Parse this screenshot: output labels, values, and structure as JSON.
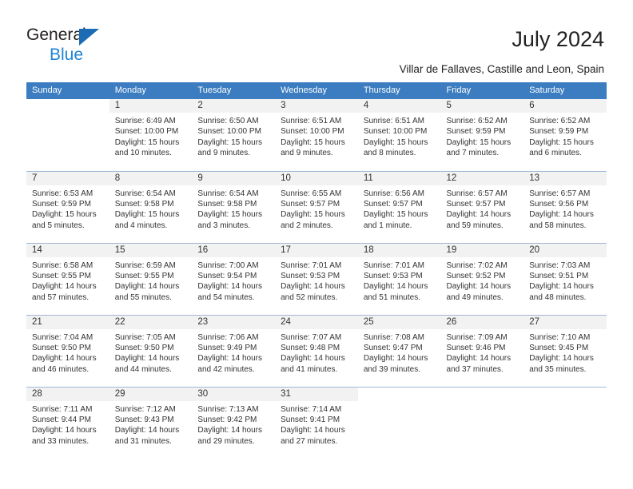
{
  "brand": {
    "name_part1": "General",
    "name_part2": "Blue",
    "logo_icon": "triangle-logo-icon",
    "color_dark": "#231f20",
    "color_blue": "#1f83d4",
    "color_triangle": "#1b6cb5"
  },
  "header": {
    "title": "July 2024",
    "subtitle": "Villar de Fallaves, Castille and Leon, Spain"
  },
  "theme": {
    "header_row_bg": "#3b7dc0",
    "header_row_text": "#ffffff",
    "daynum_band_bg": "#f2f2f2",
    "row_separator": "#9fb8d4",
    "body_text": "#333333"
  },
  "calendar": {
    "weekday_headers": [
      "Sunday",
      "Monday",
      "Tuesday",
      "Wednesday",
      "Thursday",
      "Friday",
      "Saturday"
    ],
    "weeks": [
      [
        {
          "day": "",
          "lines": []
        },
        {
          "day": "1",
          "lines": [
            "Sunrise: 6:49 AM",
            "Sunset: 10:00 PM",
            "Daylight: 15 hours",
            "and 10 minutes."
          ]
        },
        {
          "day": "2",
          "lines": [
            "Sunrise: 6:50 AM",
            "Sunset: 10:00 PM",
            "Daylight: 15 hours",
            "and 9 minutes."
          ]
        },
        {
          "day": "3",
          "lines": [
            "Sunrise: 6:51 AM",
            "Sunset: 10:00 PM",
            "Daylight: 15 hours",
            "and 9 minutes."
          ]
        },
        {
          "day": "4",
          "lines": [
            "Sunrise: 6:51 AM",
            "Sunset: 10:00 PM",
            "Daylight: 15 hours",
            "and 8 minutes."
          ]
        },
        {
          "day": "5",
          "lines": [
            "Sunrise: 6:52 AM",
            "Sunset: 9:59 PM",
            "Daylight: 15 hours",
            "and 7 minutes."
          ]
        },
        {
          "day": "6",
          "lines": [
            "Sunrise: 6:52 AM",
            "Sunset: 9:59 PM",
            "Daylight: 15 hours",
            "and 6 minutes."
          ]
        }
      ],
      [
        {
          "day": "7",
          "lines": [
            "Sunrise: 6:53 AM",
            "Sunset: 9:59 PM",
            "Daylight: 15 hours",
            "and 5 minutes."
          ]
        },
        {
          "day": "8",
          "lines": [
            "Sunrise: 6:54 AM",
            "Sunset: 9:58 PM",
            "Daylight: 15 hours",
            "and 4 minutes."
          ]
        },
        {
          "day": "9",
          "lines": [
            "Sunrise: 6:54 AM",
            "Sunset: 9:58 PM",
            "Daylight: 15 hours",
            "and 3 minutes."
          ]
        },
        {
          "day": "10",
          "lines": [
            "Sunrise: 6:55 AM",
            "Sunset: 9:57 PM",
            "Daylight: 15 hours",
            "and 2 minutes."
          ]
        },
        {
          "day": "11",
          "lines": [
            "Sunrise: 6:56 AM",
            "Sunset: 9:57 PM",
            "Daylight: 15 hours",
            "and 1 minute."
          ]
        },
        {
          "day": "12",
          "lines": [
            "Sunrise: 6:57 AM",
            "Sunset: 9:57 PM",
            "Daylight: 14 hours",
            "and 59 minutes."
          ]
        },
        {
          "day": "13",
          "lines": [
            "Sunrise: 6:57 AM",
            "Sunset: 9:56 PM",
            "Daylight: 14 hours",
            "and 58 minutes."
          ]
        }
      ],
      [
        {
          "day": "14",
          "lines": [
            "Sunrise: 6:58 AM",
            "Sunset: 9:55 PM",
            "Daylight: 14 hours",
            "and 57 minutes."
          ]
        },
        {
          "day": "15",
          "lines": [
            "Sunrise: 6:59 AM",
            "Sunset: 9:55 PM",
            "Daylight: 14 hours",
            "and 55 minutes."
          ]
        },
        {
          "day": "16",
          "lines": [
            "Sunrise: 7:00 AM",
            "Sunset: 9:54 PM",
            "Daylight: 14 hours",
            "and 54 minutes."
          ]
        },
        {
          "day": "17",
          "lines": [
            "Sunrise: 7:01 AM",
            "Sunset: 9:53 PM",
            "Daylight: 14 hours",
            "and 52 minutes."
          ]
        },
        {
          "day": "18",
          "lines": [
            "Sunrise: 7:01 AM",
            "Sunset: 9:53 PM",
            "Daylight: 14 hours",
            "and 51 minutes."
          ]
        },
        {
          "day": "19",
          "lines": [
            "Sunrise: 7:02 AM",
            "Sunset: 9:52 PM",
            "Daylight: 14 hours",
            "and 49 minutes."
          ]
        },
        {
          "day": "20",
          "lines": [
            "Sunrise: 7:03 AM",
            "Sunset: 9:51 PM",
            "Daylight: 14 hours",
            "and 48 minutes."
          ]
        }
      ],
      [
        {
          "day": "21",
          "lines": [
            "Sunrise: 7:04 AM",
            "Sunset: 9:50 PM",
            "Daylight: 14 hours",
            "and 46 minutes."
          ]
        },
        {
          "day": "22",
          "lines": [
            "Sunrise: 7:05 AM",
            "Sunset: 9:50 PM",
            "Daylight: 14 hours",
            "and 44 minutes."
          ]
        },
        {
          "day": "23",
          "lines": [
            "Sunrise: 7:06 AM",
            "Sunset: 9:49 PM",
            "Daylight: 14 hours",
            "and 42 minutes."
          ]
        },
        {
          "day": "24",
          "lines": [
            "Sunrise: 7:07 AM",
            "Sunset: 9:48 PM",
            "Daylight: 14 hours",
            "and 41 minutes."
          ]
        },
        {
          "day": "25",
          "lines": [
            "Sunrise: 7:08 AM",
            "Sunset: 9:47 PM",
            "Daylight: 14 hours",
            "and 39 minutes."
          ]
        },
        {
          "day": "26",
          "lines": [
            "Sunrise: 7:09 AM",
            "Sunset: 9:46 PM",
            "Daylight: 14 hours",
            "and 37 minutes."
          ]
        },
        {
          "day": "27",
          "lines": [
            "Sunrise: 7:10 AM",
            "Sunset: 9:45 PM",
            "Daylight: 14 hours",
            "and 35 minutes."
          ]
        }
      ],
      [
        {
          "day": "28",
          "lines": [
            "Sunrise: 7:11 AM",
            "Sunset: 9:44 PM",
            "Daylight: 14 hours",
            "and 33 minutes."
          ]
        },
        {
          "day": "29",
          "lines": [
            "Sunrise: 7:12 AM",
            "Sunset: 9:43 PM",
            "Daylight: 14 hours",
            "and 31 minutes."
          ]
        },
        {
          "day": "30",
          "lines": [
            "Sunrise: 7:13 AM",
            "Sunset: 9:42 PM",
            "Daylight: 14 hours",
            "and 29 minutes."
          ]
        },
        {
          "day": "31",
          "lines": [
            "Sunrise: 7:14 AM",
            "Sunset: 9:41 PM",
            "Daylight: 14 hours",
            "and 27 minutes."
          ]
        },
        {
          "day": "",
          "lines": []
        },
        {
          "day": "",
          "lines": []
        },
        {
          "day": "",
          "lines": []
        }
      ]
    ]
  }
}
